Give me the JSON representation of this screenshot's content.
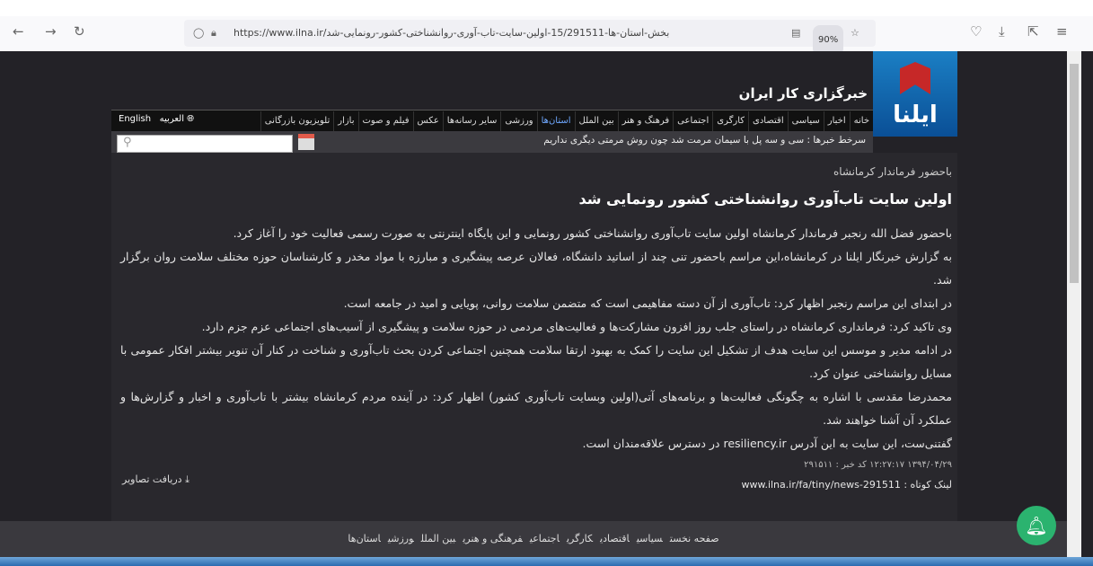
{
  "browser": {
    "url": "https://www.ilna.ir/بخش-استان-ها-15/291511-اولین-سایت-تاب-آوری-روانشناختی-کشور-رونمایی-شد",
    "zoom": "90%"
  },
  "site": {
    "name": "خبرگزاری کار ایران",
    "logo_text": "ایلنا"
  },
  "nav": [
    "خانه",
    "اخبار",
    "سیاسی",
    "اقتصادی",
    "کارگری",
    "اجتماعی",
    "فرهنگ و هنر",
    "بین الملل",
    "استان‌ها",
    "ورزشی",
    "سایر رسانه‌ها",
    "عکس",
    "فیلم و صوت",
    "بازار",
    "تلویزیون بازرگانی"
  ],
  "lang": {
    "english": "English",
    "arabic": "العربیه"
  },
  "ticker": "سرخط خبرها : سی و سه پل با سیمان مرمت شد چون روش مرمتی دیگری نداریم",
  "article": {
    "supertitle": "باحضور فرماندار کرمانشاه",
    "title": "اولین سایت تاب‌آوری روانشناختی کشور رونمایی شد",
    "paragraphs": [
      "باحضور فضل الله رنجبر فرماندار کرمانشاه اولین سایت تاب‌آوری روانشناختی کشور رونمایی و این پایگاه اینترنتی به صورت رسمی فعالیت خود را آغاز کرد.",
      "به گزارش خبرنگار ایلنا در کرمانشاه،این مراسم باحضور تنی چند از اساتید دانشگاه، فعالان عرصه پیشگیری و مبارزه با مواد مخدر و کارشناسان حوزه مختلف سلامت روان برگزار شد.",
      "در ابتدای این مراسم رنجبر اظهار کرد: تاب‌آوری از آن دسته مفاهیمی است که متضمن سلامت روانی، پویایی و امید در جامعه است.",
      "وی تاکید کرد: فرمانداری کرمانشاه در راستای جلب روز افزون مشارکت‌ها و فعالیت‌های مردمی در حوزه سلامت و پیشگیری از آسیب‌های اجتماعی عزم جزم دارد.",
      "در ادامه مدیر و موسس این سایت هدف از تشکیل این سایت را کمک به بهبود ارتقا سلامت همچنین اجتماعی کردن بحث تاب‌آوری و شناخت در کنار آن تنویر بیشتر افکار عمومی با مسایل روانشناختی عنوان کرد.",
      "محمدرضا مقدسی با اشاره به چگونگی فعالیت‌ها و برنامه‌های آتی(اولین وبسایت تاب‌آوری کشور) اظهار کرد: در آینده مردم کرمانشاه بیشتر با تاب‌آوری و اخبار و گزارش‌ها و عملکرد آن آشنا خواهند شد.",
      "گفتنی‌ست، این سایت به این آدرس resiliency.ir در دسترس علاقه‌مندان است."
    ],
    "meta": "۱۳۹۴/۰۴/۲۹ ۱۲:۲۷:۱۷ کد خبر : ۲۹۱۵۱۱",
    "short_link_label": "لینک کوتاه :",
    "short_link": "www.ilna.ir/fa/tiny/news-291511",
    "download_images": "دریافت تصاویر"
  },
  "footer": [
    "صفحه نخست",
    "سیاسی",
    "اقتصادی",
    "کارگری",
    "اجتماعی",
    "فرهنگی و هنری",
    "بین الملل",
    "ورزشی",
    "استان‌ها"
  ]
}
